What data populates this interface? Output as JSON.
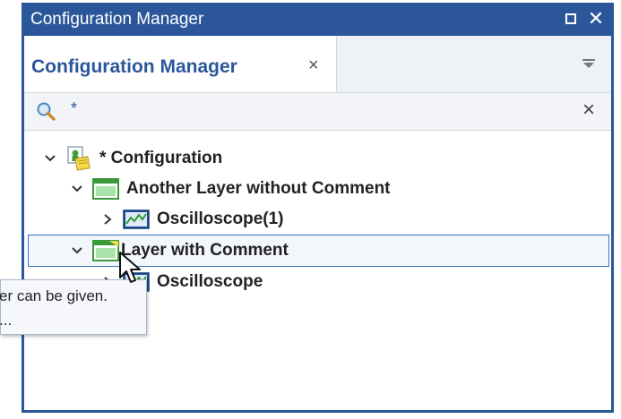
{
  "window": {
    "title": "Configuration Manager"
  },
  "tab": {
    "label": "Configuration Manager",
    "close_glyph": "×"
  },
  "search": {
    "value": "*",
    "clear_glyph": "×"
  },
  "tree": {
    "configuration": {
      "label": "* Configuration"
    },
    "layer1": {
      "label": "Another Layer without Comment"
    },
    "layer1_child": {
      "label": "Oscilloscope(1)"
    },
    "layer2": {
      "label": "Layer with Comment"
    },
    "layer2_child": {
      "label": "Oscilloscope"
    }
  },
  "tooltip": {
    "line1": "er can be given.",
    "line2": "..."
  },
  "colors": {
    "accent": "#2b579a",
    "selection_border": "#3a6fbf",
    "layer_green": "#2eb82e"
  },
  "icons": [
    "search-icon",
    "close-icon",
    "restore-icon",
    "menu-dropdown-icon",
    "chevron-down-icon",
    "chevron-right-icon",
    "configuration-icon",
    "layer-icon",
    "oscilloscope-icon",
    "mouse-cursor-icon"
  ]
}
